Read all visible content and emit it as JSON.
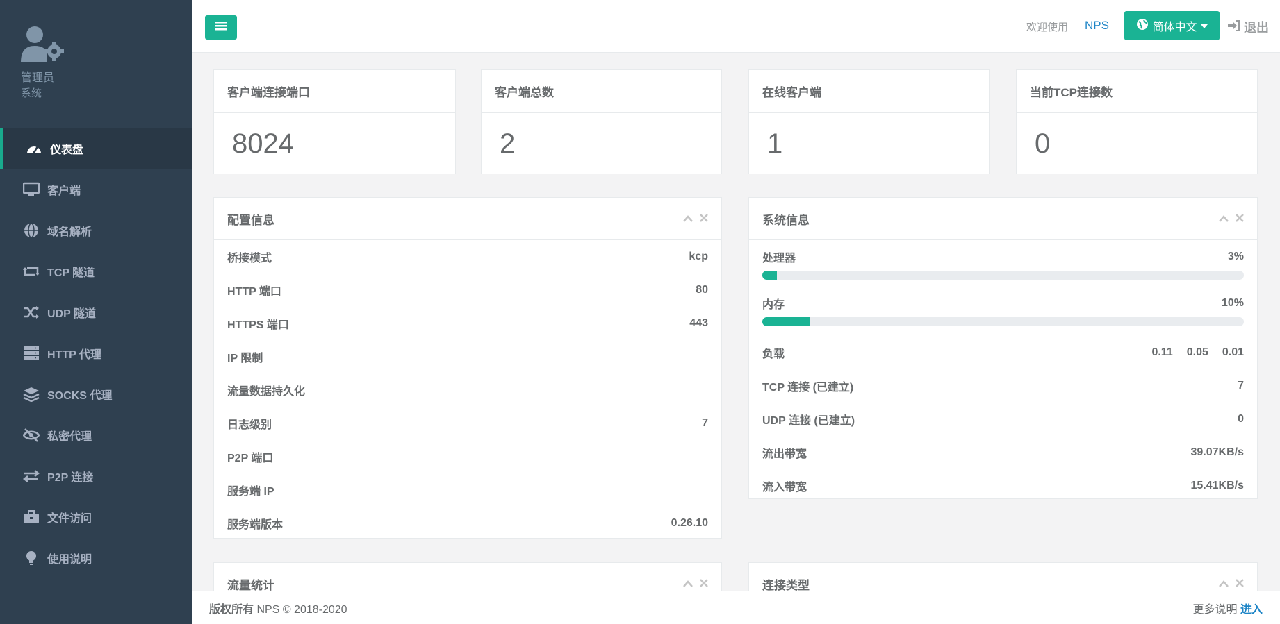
{
  "sidebar": {
    "profile": {
      "name": "管理员",
      "role": "系统"
    },
    "items": [
      {
        "label": "仪表盘",
        "icon": "dashboard-icon",
        "active": true
      },
      {
        "label": "客户端",
        "icon": "desktop-icon"
      },
      {
        "label": "域名解析",
        "icon": "globe-icon"
      },
      {
        "label": "TCP 隧道",
        "icon": "retweet-icon"
      },
      {
        "label": "UDP 隧道",
        "icon": "random-icon"
      },
      {
        "label": "HTTP 代理",
        "icon": "server-icon"
      },
      {
        "label": "SOCKS 代理",
        "icon": "layers-icon"
      },
      {
        "label": "私密代理",
        "icon": "eye-slash-icon"
      },
      {
        "label": "P2P 连接",
        "icon": "exchange-icon"
      },
      {
        "label": "文件访问",
        "icon": "briefcase-icon"
      },
      {
        "label": "使用说明",
        "icon": "lightbulb-icon"
      }
    ]
  },
  "header": {
    "welcome": "欢迎使用",
    "brand": "NPS",
    "language": "简体中文",
    "logout": "退出"
  },
  "stats": [
    {
      "title": "客户端连接端口",
      "value": "8024"
    },
    {
      "title": "客户端总数",
      "value": "2"
    },
    {
      "title": "在线客户端",
      "value": "1"
    },
    {
      "title": "当前TCP连接数",
      "value": "0"
    }
  ],
  "config_panel": {
    "title": "配置信息",
    "rows": [
      {
        "label": "桥接模式",
        "value": "kcp"
      },
      {
        "label": "HTTP 端口",
        "value": "80"
      },
      {
        "label": "HTTPS 端口",
        "value": "443"
      },
      {
        "label": "IP 限制",
        "value": ""
      },
      {
        "label": "流量数据持久化",
        "value": ""
      },
      {
        "label": "日志级别",
        "value": "7"
      },
      {
        "label": "P2P 端口",
        "value": ""
      },
      {
        "label": "服务端 IP",
        "value": ""
      },
      {
        "label": "服务端版本",
        "value": "0.26.10"
      }
    ]
  },
  "system_panel": {
    "title": "系统信息",
    "cpu": {
      "label": "处理器",
      "value": "3%",
      "percent": 3
    },
    "memory": {
      "label": "内存",
      "value": "10%",
      "percent": 10
    },
    "load": {
      "label": "负载",
      "values": [
        "0.11",
        "0.05",
        "0.01"
      ]
    },
    "rows": [
      {
        "label": "TCP 连接 (已建立)",
        "value": "7"
      },
      {
        "label": "UDP 连接 (已建立)",
        "value": "0"
      },
      {
        "label": "流出带宽",
        "value": "39.07KB/s"
      },
      {
        "label": "流入带宽",
        "value": "15.41KB/s"
      }
    ]
  },
  "traffic_panel": {
    "title": "流量统计"
  },
  "conn_type_panel": {
    "title": "连接类型"
  },
  "footer": {
    "copyright_label": "版权所有",
    "copyright_text": "NPS © 2018-2020",
    "more_label": "更多说明",
    "more_link": "进入"
  },
  "colors": {
    "sidebar": "#2f4050",
    "accent": "#1ab394",
    "link": "#1c84c6"
  }
}
